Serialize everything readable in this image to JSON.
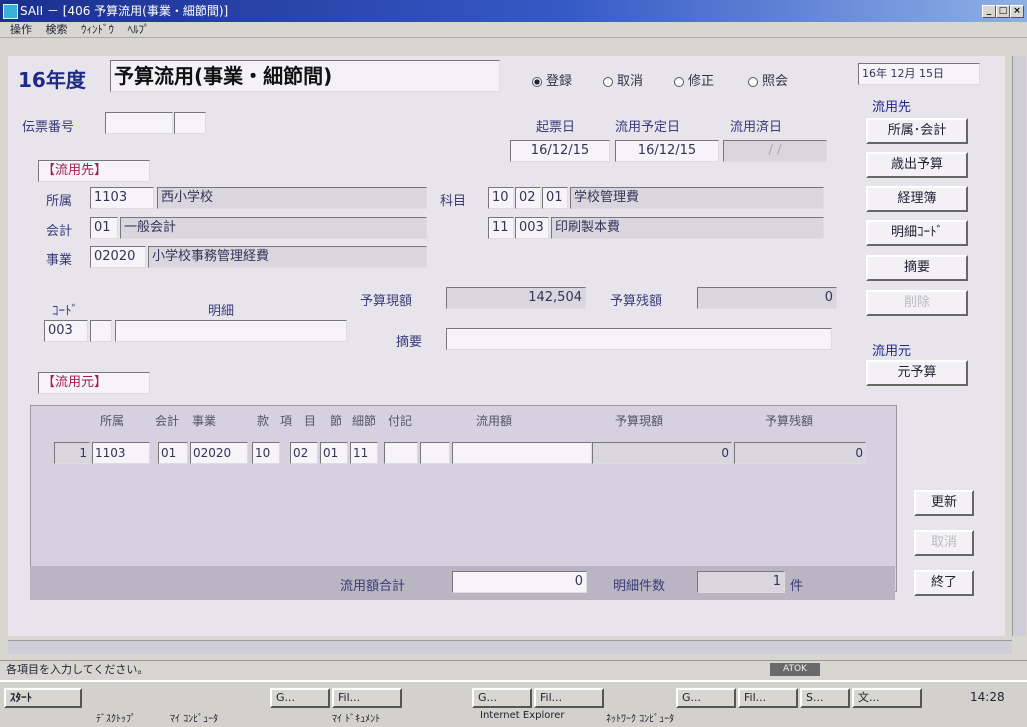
{
  "window": {
    "title": "SAII － [406 予算流用(事業・細節間)]"
  },
  "menu": [
    "操作",
    "検索",
    "ｳｨﾝﾄﾞｳ",
    "ﾍﾙﾌﾟ"
  ],
  "header": {
    "fiscal_year": "16年度",
    "form_title": "予算流用(事業・細節間)",
    "date": "16年 12月 15日",
    "modes": [
      {
        "label": "登録",
        "selected": true
      },
      {
        "label": "取消",
        "selected": false
      },
      {
        "label": "修正",
        "selected": false
      },
      {
        "label": "照会",
        "selected": false
      }
    ]
  },
  "voucher": {
    "label": "伝票番号",
    "value1": "",
    "value2": ""
  },
  "dates": {
    "issue_label": "起票日",
    "issue_value": "16/12/15",
    "plan_label": "流用予定日",
    "plan_value": "16/12/15",
    "done_label": "流用済日",
    "done_value": " / / "
  },
  "dest": {
    "section_label": "【流用先】",
    "shozoku_label": "所属",
    "shozoku_code": "1103",
    "shozoku_name": "西小学校",
    "kaikei_label": "会計",
    "kaikei_code": "01",
    "kaikei_name": "一般会計",
    "jigyo_label": "事業",
    "jigyo_code": "02020",
    "jigyo_name": "小学校事務管理経費",
    "kamoku_label": "科目",
    "kamoku_c1": "10",
    "kamoku_c2": "02",
    "kamoku_c3": "01",
    "kamoku_name": "学校管理費",
    "setsu_c1": "11",
    "setsu_c2": "003",
    "setsu_name": "印刷製本費",
    "code_label": "ｺｰﾄﾞ",
    "code_value": "003",
    "code_extra": "",
    "meisai_label": "明細",
    "meisai_value": "",
    "budget_current_label": "予算現額",
    "budget_current_value": "142,504",
    "budget_remain_label": "予算残額",
    "budget_remain_value": "0",
    "tekiyo_label": "摘要",
    "tekiyo_value": ""
  },
  "right_panel": {
    "dest_label": "流用先",
    "buttons": [
      "所属･会計",
      "歳出予算",
      "経理簿",
      "明細ｺｰﾄﾞ",
      "摘要",
      "削除"
    ],
    "source_label": "流用元",
    "source_button": "元予算"
  },
  "source": {
    "section_label": "【流用元】",
    "columns": [
      "所属",
      "会計",
      "事業",
      "款",
      "項",
      "目",
      "節",
      "細節",
      "付記",
      "流用額",
      "予算現額",
      "予算残額"
    ],
    "row": {
      "no": "1",
      "shozoku": "1103",
      "kaikei": "01",
      "jigyo": "02020",
      "kan": "10",
      "kou": "02",
      "moku": "01",
      "setsu": "11",
      "saisetsu": "",
      "fuki": "",
      "amount": "",
      "budget_current": "0",
      "budget_remain": "0"
    },
    "total_label": "流用額合計",
    "total_value": "0",
    "count_label": "明細件数",
    "count_value": "1",
    "count_unit": "件"
  },
  "actions": {
    "update": "更新",
    "clear": "取消",
    "exit": "終了"
  },
  "statusbar": {
    "message": "各項目を入力してください。",
    "indicator": "ATOK"
  },
  "taskbar": {
    "start": "ｽﾀｰﾄ",
    "items": [
      "G...",
      "Fil...",
      "G...",
      "Fil...",
      "G...",
      "Fil...",
      "S...",
      "文..."
    ],
    "quick": [
      "ﾃﾞｽｸﾄｯﾌﾟ",
      "ﾏｲ ｺﾝﾋﾟｭｰﾀ",
      "ﾏｲ ﾄﾞｷｭﾒﾝﾄ",
      "Internet Explorer",
      "ﾈｯﾄﾜｰｸ ｺﾝﾋﾟｭｰﾀ"
    ],
    "clock": "14:28"
  }
}
